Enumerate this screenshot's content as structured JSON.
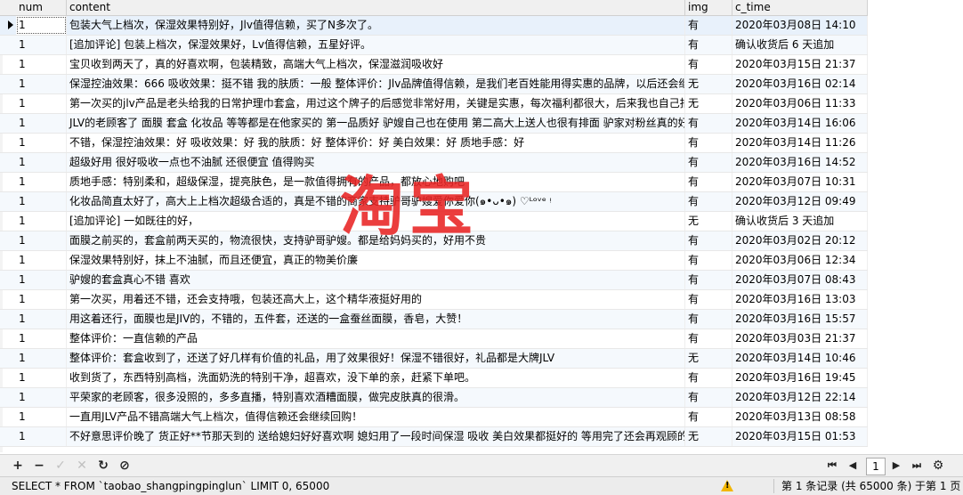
{
  "columns": [
    "num",
    "content",
    "img",
    "c_time"
  ],
  "rows": [
    {
      "num": "1",
      "content": "包装大气上档次，保湿效果特别好，Jlv值得信赖，买了N多次了。",
      "img": "有",
      "c_time": "2020年03月08日 14:10"
    },
    {
      "num": "1",
      "content": "[追加评论] 包装上档次，保湿效果好，Lv值得信赖，五星好评。",
      "img": "有",
      "c_time": "确认收货后 6 天追加"
    },
    {
      "num": "1",
      "content": "宝贝收到两天了，真的好喜欢啊，包装精致，高端大气上档次，保湿滋润吸收好",
      "img": "有",
      "c_time": "2020年03月15日 21:37"
    },
    {
      "num": "1",
      "content": "保湿控油效果：666 吸收效果：挺不错 我的肤质：一般 整体评价：Jlv品牌值得信赖，是我们老百姓能用得实惠的品牌，以后还会继",
      "img": "无",
      "c_time": "2020年03月16日 02:14"
    },
    {
      "num": "1",
      "content": "第一次买的jlv产品是老头给我的日常护理巾套盒，用过这个牌子的后感觉非常好用，关键是实惠，每次福利都很大，后来我也自己拍了",
      "img": "无",
      "c_time": "2020年03月06日 11:33"
    },
    {
      "num": "1",
      "content": "JLV的老顾客了 面膜 套盒 化妆品 等等都是在他家买的 第一品质好 驴嫂自己也在使用 第二高大上送人也很有排面 驴家对粉丝真的好",
      "img": "有",
      "c_time": "2020年03月14日 16:06"
    },
    {
      "num": "1",
      "content": "不错，保湿控油效果：好 吸收效果：好 我的肤质：好 整体评价：好 美白效果：好 质地手感：好",
      "img": "有",
      "c_time": "2020年03月14日 11:26"
    },
    {
      "num": "1",
      "content": "超级好用 很好吸收一点也不油腻 还很便宜 值得购买",
      "img": "有",
      "c_time": "2020年03月16日 14:52"
    },
    {
      "num": "1",
      "content": "质地手感：特别柔和，超级保湿，提亮肤色，是一款值得拥有的产品，都放心地购吧",
      "img": "有",
      "c_time": "2020年03月07日 10:31"
    },
    {
      "num": "1",
      "content": "化妆品简直太好了，高大上上档次超级合适的，真是不错的商家支持驴哥驴嫂爱你爱你(๑•ᴗ•๑) ♡ᴸᵒᵛᵉ ᵎ",
      "img": "有",
      "c_time": "2020年03月12日 09:49"
    },
    {
      "num": "1",
      "content": "[追加评论] 一如既往的好，",
      "img": "无",
      "c_time": "确认收货后 3 天追加"
    },
    {
      "num": "1",
      "content": "面膜之前买的，套盒前两天买的，物流很快，支持驴哥驴嫂。都是给妈妈买的，好用不贵",
      "img": "有",
      "c_time": "2020年03月02日 20:12"
    },
    {
      "num": "1",
      "content": "保湿效果特别好，抹上不油腻，而且还便宜，真正的物美价廉",
      "img": "有",
      "c_time": "2020年03月06日 12:34"
    },
    {
      "num": "1",
      "content": "驴嫂的套盒真心不错 喜欢",
      "img": "有",
      "c_time": "2020年03月07日 08:43"
    },
    {
      "num": "1",
      "content": "第一次买，用着还不错，还会支持哦，包装还高大上，这个精华液挺好用的",
      "img": "有",
      "c_time": "2020年03月16日 13:03"
    },
    {
      "num": "1",
      "content": "用这着还行，面膜也是JIV的，不错的，五件套，还送的一盒蚕丝面膜，香皂，大赞！",
      "img": "有",
      "c_time": "2020年03月16日 15:57"
    },
    {
      "num": "1",
      "content": "整体评价：一直信赖的产品",
      "img": "有",
      "c_time": "2020年03月03日 21:37"
    },
    {
      "num": "1",
      "content": "整体评价：套盒收到了，还送了好几样有价值的礼品，用了效果很好！保湿不错很好，礼品都是大牌JLV",
      "img": "无",
      "c_time": "2020年03月14日 10:46"
    },
    {
      "num": "1",
      "content": "收到货了，东西特别高档，洗面奶洗的特别干净，超喜欢，没下单的亲，赶紧下单吧。",
      "img": "有",
      "c_time": "2020年03月16日 19:45"
    },
    {
      "num": "1",
      "content": "平荣家的老顾客，很多没照的，多多直播，特别喜欢酒糟面膜，做完皮肤真的很滑。",
      "img": "有",
      "c_time": "2020年03月12日 22:14"
    },
    {
      "num": "1",
      "content": "一直用JLV产品不错高端大气上档次，值得信赖还会继续回购！",
      "img": "有",
      "c_time": "2020年03月13日 08:58"
    },
    {
      "num": "1",
      "content": "不好意思评价晚了 货正好**节那天到的 送给媳妇好好喜欢啊 媳妇用了一段时间保湿 吸收 美白效果都挺好的 等用完了还会再观顾的",
      "img": "无",
      "c_time": "2020年03月15日 01:53"
    }
  ],
  "watermark": "淘宝",
  "toolbar": {
    "add": "+",
    "delete": "−",
    "apply": "✓",
    "discard": "✕",
    "refresh": "↻",
    "stop": "⊘",
    "first": "⏮",
    "prev": "◀",
    "page": "1",
    "next": "▶",
    "last": "⏭",
    "settings": "⚙"
  },
  "status": {
    "sql": "SELECT * FROM `taobao_shangpingpinglun` LIMIT 0, 65000",
    "records": "第 1 条记录 (共 65000 条) 于第 1 页"
  },
  "colors": {
    "watermark": "#e82323",
    "header_bg": "#f0f0f0",
    "warning": "#f2b600"
  }
}
